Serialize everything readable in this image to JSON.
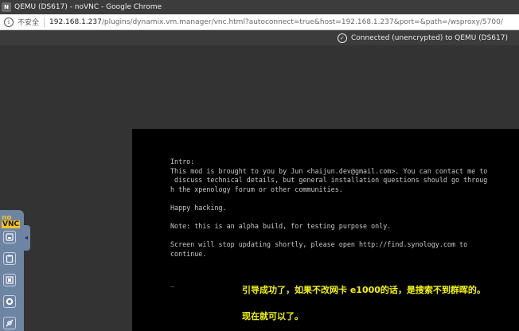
{
  "window": {
    "title": "QEMU (DS617) - noVNC - Google Chrome",
    "icon_text": "N"
  },
  "addressbar": {
    "security_label": "不安全",
    "url_host": "192.168.1.237",
    "url_path": "/plugins/dynamix.vm.manager/vnc.html?autoconnect=true&host=192.168.1.237&port=&path=/wsproxy/5700/"
  },
  "novnc": {
    "status": "Connected (unencrypted) to QEMU (DS617)",
    "logo_top": "no",
    "logo_bottom": "VNC",
    "buttons": [
      "keyboard-icon",
      "clipboard-icon",
      "fullscreen-icon",
      "gear-icon",
      "disconnect-icon"
    ]
  },
  "console": {
    "text": "Intro:\nThis mod is brought to you by Jun <haijun.dev@gmail.com>. You can contact me to\n discuss technical details, but general installation questions should go throug\nh the xpenology forum or other communities.\n\nHappy hacking.\n\nNote: this is an alpha build, for testing purpose only.\n\nScreen will stop updating shortly, please open http://find.synology.com to\ncontinue.",
    "prompt": "_"
  },
  "annotations": {
    "line1": "引导成功了，如果不改网卡 e1000的话，是搜索不到群晖的。",
    "line2": "现在就可以了。"
  },
  "colors": {
    "annotation": "#f5f500",
    "control_bar": "#6e84a3",
    "logo": "#f8c41b"
  }
}
